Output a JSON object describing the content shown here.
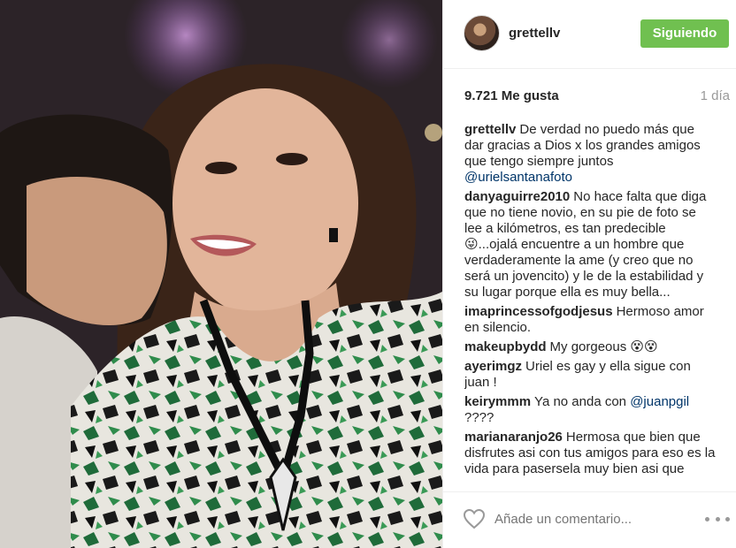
{
  "post": {
    "username": "grettellv",
    "follow_label": "Siguiendo",
    "likes": "9.721 Me gusta",
    "time_ago": "1 día"
  },
  "comments": [
    {
      "user": "grettellv",
      "text": "De verdad no puedo más que dar gracias a Dios x los grandes amigos que tengo siempre juntos",
      "mention": "@urielsantanafoto"
    },
    {
      "user": "danyaguirre2010",
      "text": "No hace falta que diga que no tiene novio, en su pie de foto se lee a kilómetros, es tan predecible 😜...ojalá encuentre a un hombre que verdaderamente la ame (y creo que no será un jovencito) y le de la estabilidad y su lugar porque ella es muy bella...",
      "mention": ""
    },
    {
      "user": "imaprincessofgodjesus",
      "text": "Hermoso amor en silencio.",
      "mention": ""
    },
    {
      "user": "makeupbydd",
      "text": "My gorgeous 😵😵",
      "mention": ""
    },
    {
      "user": "ayerimgz",
      "text": "Uriel es gay y ella sigue con juan !",
      "mention": ""
    },
    {
      "user": "keirymmm",
      "text": "Ya no anda con",
      "mention": "@juanpgil",
      "text_after": "????"
    },
    {
      "user": "marianaranjo26",
      "text": "Hermosa que bien que disfrutes asi con tus amigos para eso es la vida para pasersela muy bien asi que",
      "mention": ""
    }
  ],
  "footer": {
    "comment_placeholder": "Añade un comentario...",
    "like_icon": "heart-outline-icon",
    "more_icon": "more-options-icon"
  },
  "colors": {
    "follow_button": "#70c050",
    "mention": "#003569",
    "muted": "#999999"
  }
}
